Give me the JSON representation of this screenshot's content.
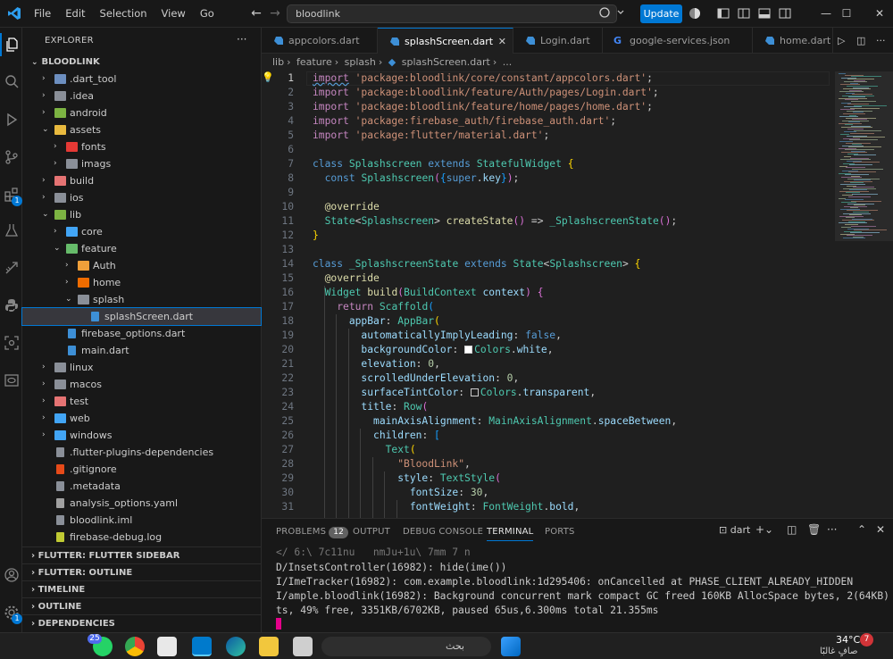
{
  "titlebar": {
    "menu": [
      "File",
      "Edit",
      "Selection",
      "View",
      "Go"
    ],
    "search": "bloodlink",
    "update_label": "Update"
  },
  "sidebar": {
    "title": "EXPLORER",
    "root": "BLOODLINK",
    "tree": [
      {
        "label": ".dart_tool",
        "depth": 0,
        "type": "folder",
        "open": false
      },
      {
        "label": ".idea",
        "depth": 0,
        "type": "folder",
        "open": false
      },
      {
        "label": "android",
        "depth": 0,
        "type": "folder",
        "open": false
      },
      {
        "label": "assets",
        "depth": 0,
        "type": "folder",
        "open": true
      },
      {
        "label": "fonts",
        "depth": 1,
        "type": "folder",
        "open": false
      },
      {
        "label": "imags",
        "depth": 1,
        "type": "folder",
        "open": false
      },
      {
        "label": "build",
        "depth": 0,
        "type": "folder",
        "open": false
      },
      {
        "label": "ios",
        "depth": 0,
        "type": "folder",
        "open": false
      },
      {
        "label": "lib",
        "depth": 0,
        "type": "folder",
        "open": true
      },
      {
        "label": "core",
        "depth": 1,
        "type": "folder",
        "open": false
      },
      {
        "label": "feature",
        "depth": 1,
        "type": "folder",
        "open": true
      },
      {
        "label": "Auth",
        "depth": 2,
        "type": "folder",
        "open": false
      },
      {
        "label": "home",
        "depth": 2,
        "type": "folder",
        "open": false
      },
      {
        "label": "splash",
        "depth": 2,
        "type": "folder",
        "open": true
      },
      {
        "label": "splashScreen.dart",
        "depth": 3,
        "type": "dart",
        "selected": true
      },
      {
        "label": "firebase_options.dart",
        "depth": 1,
        "type": "dart"
      },
      {
        "label": "main.dart",
        "depth": 1,
        "type": "dart"
      },
      {
        "label": "linux",
        "depth": 0,
        "type": "folder",
        "open": false
      },
      {
        "label": "macos",
        "depth": 0,
        "type": "folder",
        "open": false
      },
      {
        "label": "test",
        "depth": 0,
        "type": "folder",
        "open": false
      },
      {
        "label": "web",
        "depth": 0,
        "type": "folder",
        "open": false
      },
      {
        "label": "windows",
        "depth": 0,
        "type": "folder",
        "open": false
      },
      {
        "label": ".flutter-plugins-dependencies",
        "depth": 0,
        "type": "file"
      },
      {
        "label": ".gitignore",
        "depth": 0,
        "type": "git"
      },
      {
        "label": ".metadata",
        "depth": 0,
        "type": "file"
      },
      {
        "label": "analysis_options.yaml",
        "depth": 0,
        "type": "yaml"
      },
      {
        "label": "bloodlink.iml",
        "depth": 0,
        "type": "file"
      },
      {
        "label": "firebase-debug.log",
        "depth": 0,
        "type": "log"
      }
    ],
    "sections": [
      "FLUTTER: FLUTTER SIDEBAR",
      "FLUTTER: OUTLINE",
      "TIMELINE",
      "OUTLINE",
      "DEPENDENCIES"
    ]
  },
  "activity_badges": {
    "extensions": "1",
    "accounts": "1"
  },
  "tabs": [
    {
      "label": "appcolors.dart",
      "active": false
    },
    {
      "label": "splashScreen.dart",
      "active": true
    },
    {
      "label": "Login.dart",
      "active": false
    },
    {
      "label": "google-services.json",
      "active": false
    },
    {
      "label": "home.dart",
      "active": false
    }
  ],
  "breadcrumb": [
    "lib",
    "feature",
    "splash",
    "splashScreen.dart",
    "..."
  ],
  "code_lines": [
    "1",
    "2",
    "3",
    "4",
    "5",
    "6",
    "7",
    "8",
    "9",
    "10",
    "11",
    "12",
    "13",
    "14",
    "15",
    "16",
    "17",
    "18",
    "19",
    "20",
    "21",
    "22",
    "23",
    "24",
    "25",
    "26",
    "27",
    "28",
    "29",
    "30",
    "31"
  ],
  "code": {
    "l1_str": "'package:bloodlink/core/constant/appcolors.dart'",
    "l2_str": "'package:bloodlink/feature/Auth/pages/Login.dart'",
    "l3_str": "'package:bloodlink/feature/home/pages/home.dart'",
    "l4_str": "'package:firebase_auth/firebase_auth.dart'",
    "l5_str": "'package:flutter/material.dart'",
    "l28_str": "\"BloodLink\"",
    "l30_num": "30",
    "elev": "0",
    "scroll_elev": "0"
  },
  "panel": {
    "tabs": [
      "PROBLEMS",
      "OUTPUT",
      "DEBUG CONSOLE",
      "TERMINAL",
      "PORTS"
    ],
    "problems_count": "12",
    "shell": "dart",
    "terminal_lines": [
      "D/InsetsController(16982): hide(ime())",
      "I/ImeTracker(16982): com.example.bloodlink:1d295406: onCancelled at PHASE_CLIENT_ALREADY_HIDDEN",
      "I/ample.bloodlink(16982): Background concurrent mark compact GC freed 160KB AllocSpace bytes, 2(64KB) LOS objec",
      "ts, 49% free, 3351KB/6702KB, paused 65us,6.300ms total 21.355ms"
    ]
  },
  "taskbar": {
    "search": "بحث",
    "temp": "34°C",
    "weather": "صافٍ غالبًا",
    "whatsapp_badge": "25",
    "notif_badge": "7"
  },
  "colors": {
    "accent": "#0078d4",
    "bg": "#1f1f1f",
    "sidebar": "#181818"
  }
}
